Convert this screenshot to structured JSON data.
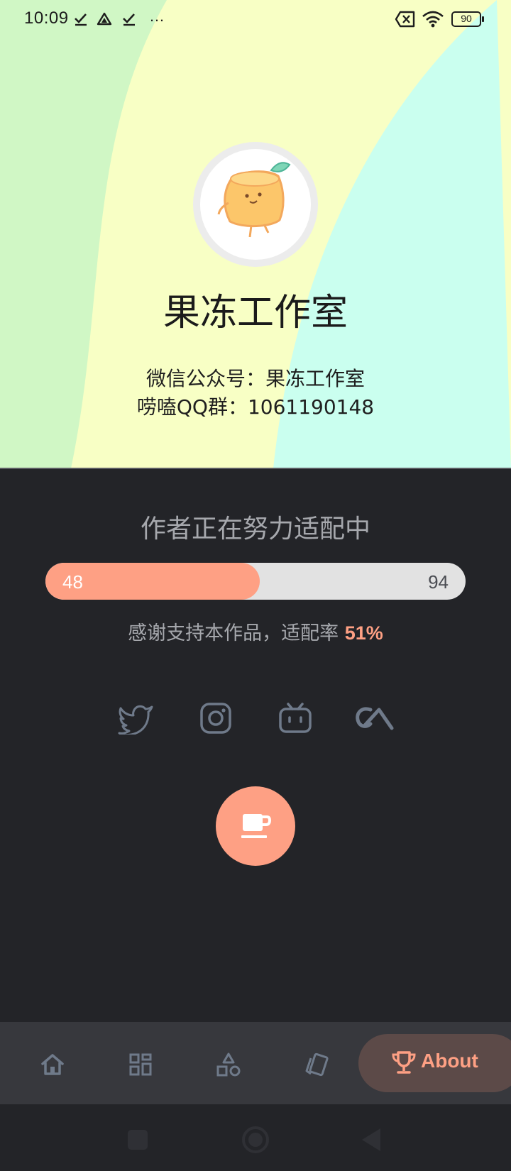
{
  "status_bar": {
    "time": "10:09",
    "more": "…",
    "battery": "90"
  },
  "profile": {
    "name": "果冻工作室",
    "wechat_line": "微信公众号：果冻工作室",
    "qq_line": "唠嗑QQ群：1061190148"
  },
  "adaptation": {
    "title": "作者正在努力适配中",
    "current": "48",
    "total": "94",
    "progress_fraction": 0.51,
    "thanks_text": "感谢支持本作品，适配率",
    "rate": "51%"
  },
  "social": [
    {
      "icon": "twitter-icon"
    },
    {
      "icon": "instagram-icon"
    },
    {
      "icon": "bilibili-icon"
    },
    {
      "icon": "coolapk-icon"
    }
  ],
  "fab": {
    "icon": "coffee-cup-icon"
  },
  "bottom_nav": {
    "items": [
      {
        "icon": "home-icon"
      },
      {
        "icon": "apps-grid-icon"
      },
      {
        "icon": "shapes-icon"
      },
      {
        "icon": "cards-icon"
      },
      {
        "icon": "trophy-icon",
        "label": "About",
        "active": true
      }
    ]
  },
  "colors": {
    "accent": "#fea084",
    "dark_bg": "#232428",
    "nav_bg": "#37383d",
    "icon_gray": "#6f7a8a"
  }
}
